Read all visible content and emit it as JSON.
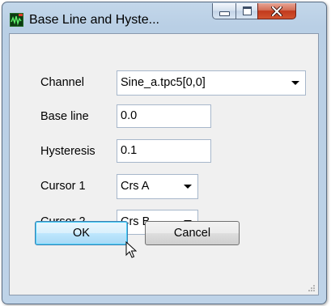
{
  "window": {
    "title": "Base Line and Hyste...",
    "icon": "waveform-app-icon",
    "controls": {
      "minimize": "minimize-icon",
      "maximize": "maximize-icon",
      "close": "close-icon"
    }
  },
  "form": {
    "channel": {
      "label": "Channel",
      "value": "Sine_a.tpc5[0,0]"
    },
    "base_line": {
      "label": "Base line",
      "value": "0.0"
    },
    "hysteresis": {
      "label": "Hysteresis",
      "value": "0.1"
    },
    "cursor1": {
      "label": "Cursor 1",
      "value": "Crs A"
    },
    "cursor2": {
      "label": "Cursor 2",
      "value": "Crs B"
    }
  },
  "buttons": {
    "ok": "OK",
    "cancel": "Cancel"
  },
  "colors": {
    "frame": "#bed3e8",
    "close_button": "#c2391c",
    "default_button_border": "#3c7fb1"
  }
}
